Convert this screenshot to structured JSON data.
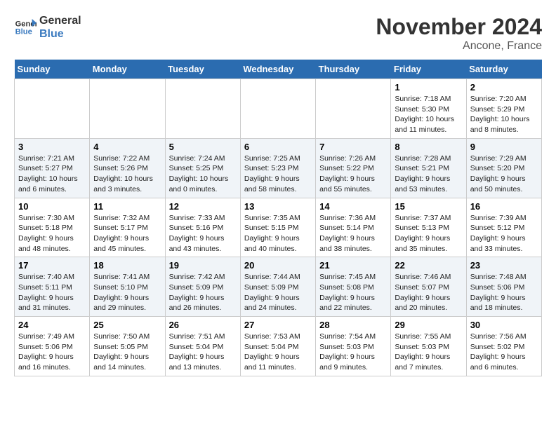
{
  "header": {
    "logo_line1": "General",
    "logo_line2": "Blue",
    "month": "November 2024",
    "location": "Ancone, France"
  },
  "weekdays": [
    "Sunday",
    "Monday",
    "Tuesday",
    "Wednesday",
    "Thursday",
    "Friday",
    "Saturday"
  ],
  "weeks": [
    [
      {
        "day": "",
        "info": ""
      },
      {
        "day": "",
        "info": ""
      },
      {
        "day": "",
        "info": ""
      },
      {
        "day": "",
        "info": ""
      },
      {
        "day": "",
        "info": ""
      },
      {
        "day": "1",
        "info": "Sunrise: 7:18 AM\nSunset: 5:30 PM\nDaylight: 10 hours and 11 minutes."
      },
      {
        "day": "2",
        "info": "Sunrise: 7:20 AM\nSunset: 5:29 PM\nDaylight: 10 hours and 8 minutes."
      }
    ],
    [
      {
        "day": "3",
        "info": "Sunrise: 7:21 AM\nSunset: 5:27 PM\nDaylight: 10 hours and 6 minutes."
      },
      {
        "day": "4",
        "info": "Sunrise: 7:22 AM\nSunset: 5:26 PM\nDaylight: 10 hours and 3 minutes."
      },
      {
        "day": "5",
        "info": "Sunrise: 7:24 AM\nSunset: 5:25 PM\nDaylight: 10 hours and 0 minutes."
      },
      {
        "day": "6",
        "info": "Sunrise: 7:25 AM\nSunset: 5:23 PM\nDaylight: 9 hours and 58 minutes."
      },
      {
        "day": "7",
        "info": "Sunrise: 7:26 AM\nSunset: 5:22 PM\nDaylight: 9 hours and 55 minutes."
      },
      {
        "day": "8",
        "info": "Sunrise: 7:28 AM\nSunset: 5:21 PM\nDaylight: 9 hours and 53 minutes."
      },
      {
        "day": "9",
        "info": "Sunrise: 7:29 AM\nSunset: 5:20 PM\nDaylight: 9 hours and 50 minutes."
      }
    ],
    [
      {
        "day": "10",
        "info": "Sunrise: 7:30 AM\nSunset: 5:18 PM\nDaylight: 9 hours and 48 minutes."
      },
      {
        "day": "11",
        "info": "Sunrise: 7:32 AM\nSunset: 5:17 PM\nDaylight: 9 hours and 45 minutes."
      },
      {
        "day": "12",
        "info": "Sunrise: 7:33 AM\nSunset: 5:16 PM\nDaylight: 9 hours and 43 minutes."
      },
      {
        "day": "13",
        "info": "Sunrise: 7:35 AM\nSunset: 5:15 PM\nDaylight: 9 hours and 40 minutes."
      },
      {
        "day": "14",
        "info": "Sunrise: 7:36 AM\nSunset: 5:14 PM\nDaylight: 9 hours and 38 minutes."
      },
      {
        "day": "15",
        "info": "Sunrise: 7:37 AM\nSunset: 5:13 PM\nDaylight: 9 hours and 35 minutes."
      },
      {
        "day": "16",
        "info": "Sunrise: 7:39 AM\nSunset: 5:12 PM\nDaylight: 9 hours and 33 minutes."
      }
    ],
    [
      {
        "day": "17",
        "info": "Sunrise: 7:40 AM\nSunset: 5:11 PM\nDaylight: 9 hours and 31 minutes."
      },
      {
        "day": "18",
        "info": "Sunrise: 7:41 AM\nSunset: 5:10 PM\nDaylight: 9 hours and 29 minutes."
      },
      {
        "day": "19",
        "info": "Sunrise: 7:42 AM\nSunset: 5:09 PM\nDaylight: 9 hours and 26 minutes."
      },
      {
        "day": "20",
        "info": "Sunrise: 7:44 AM\nSunset: 5:09 PM\nDaylight: 9 hours and 24 minutes."
      },
      {
        "day": "21",
        "info": "Sunrise: 7:45 AM\nSunset: 5:08 PM\nDaylight: 9 hours and 22 minutes."
      },
      {
        "day": "22",
        "info": "Sunrise: 7:46 AM\nSunset: 5:07 PM\nDaylight: 9 hours and 20 minutes."
      },
      {
        "day": "23",
        "info": "Sunrise: 7:48 AM\nSunset: 5:06 PM\nDaylight: 9 hours and 18 minutes."
      }
    ],
    [
      {
        "day": "24",
        "info": "Sunrise: 7:49 AM\nSunset: 5:06 PM\nDaylight: 9 hours and 16 minutes."
      },
      {
        "day": "25",
        "info": "Sunrise: 7:50 AM\nSunset: 5:05 PM\nDaylight: 9 hours and 14 minutes."
      },
      {
        "day": "26",
        "info": "Sunrise: 7:51 AM\nSunset: 5:04 PM\nDaylight: 9 hours and 13 minutes."
      },
      {
        "day": "27",
        "info": "Sunrise: 7:53 AM\nSunset: 5:04 PM\nDaylight: 9 hours and 11 minutes."
      },
      {
        "day": "28",
        "info": "Sunrise: 7:54 AM\nSunset: 5:03 PM\nDaylight: 9 hours and 9 minutes."
      },
      {
        "day": "29",
        "info": "Sunrise: 7:55 AM\nSunset: 5:03 PM\nDaylight: 9 hours and 7 minutes."
      },
      {
        "day": "30",
        "info": "Sunrise: 7:56 AM\nSunset: 5:02 PM\nDaylight: 9 hours and 6 minutes."
      }
    ]
  ]
}
